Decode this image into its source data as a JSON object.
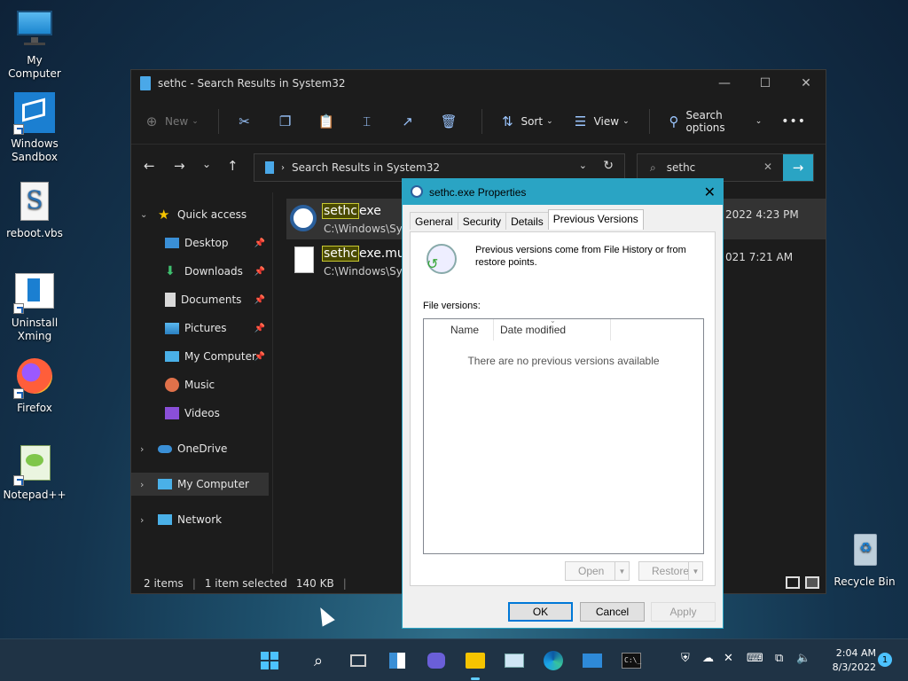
{
  "desktop": {
    "icons": [
      {
        "label": "My Computer",
        "icon": "monitor-icon"
      },
      {
        "label": "Windows Sandbox",
        "icon": "sandbox-icon"
      },
      {
        "label": "reboot.vbs",
        "icon": "script-icon"
      },
      {
        "label": "Uninstall Xming",
        "icon": "uninstall-icon"
      },
      {
        "label": "Firefox",
        "icon": "firefox-icon"
      },
      {
        "label": "Notepad++",
        "icon": "notepadpp-icon"
      },
      {
        "label": "Recycle Bin",
        "icon": "recycle-bin-icon"
      }
    ]
  },
  "explorer": {
    "title": "sethc - Search Results in System32",
    "toolbar": {
      "new_label": "New",
      "sort_label": "Sort",
      "view_label": "View",
      "search_options_label": "Search options",
      "more_label": "•••"
    },
    "address": "Search Results in System32",
    "search_value": "sethc",
    "nav": {
      "quick_access": "Quick access",
      "items": [
        "Desktop",
        "Downloads",
        "Documents",
        "Pictures",
        "My Computer",
        "Music",
        "Videos"
      ],
      "onedrive": "OneDrive",
      "my_computer": "My Computer",
      "network": "Network"
    },
    "files": [
      {
        "name_hl": "sethc",
        "name_rest": "exe",
        "path": "C:\\Windows\\Syst",
        "date": "2022 4:23 PM"
      },
      {
        "name_hl": "sethc",
        "name_rest": "exe.mui",
        "path": "C:\\Windows\\Syst",
        "date": "021 7:21 AM"
      }
    ],
    "status": {
      "items": "2 items",
      "selected": "1 item selected",
      "size": "140 KB"
    }
  },
  "dialog": {
    "title": "sethc.exe Properties",
    "tabs": [
      "General",
      "Security",
      "Details",
      "Previous Versions"
    ],
    "info": "Previous versions come from File History or from restore points.",
    "versions_label": "File versions:",
    "columns": [
      "Name",
      "Date modified"
    ],
    "empty_message": "There are no previous versions available",
    "open_label": "Open",
    "restore_label": "Restore",
    "ok_label": "OK",
    "cancel_label": "Cancel",
    "apply_label": "Apply",
    "accent": "#2aa4c4"
  },
  "taskbar": {
    "time": "2:04 AM",
    "date": "8/3/2022",
    "notification_count": "1"
  }
}
